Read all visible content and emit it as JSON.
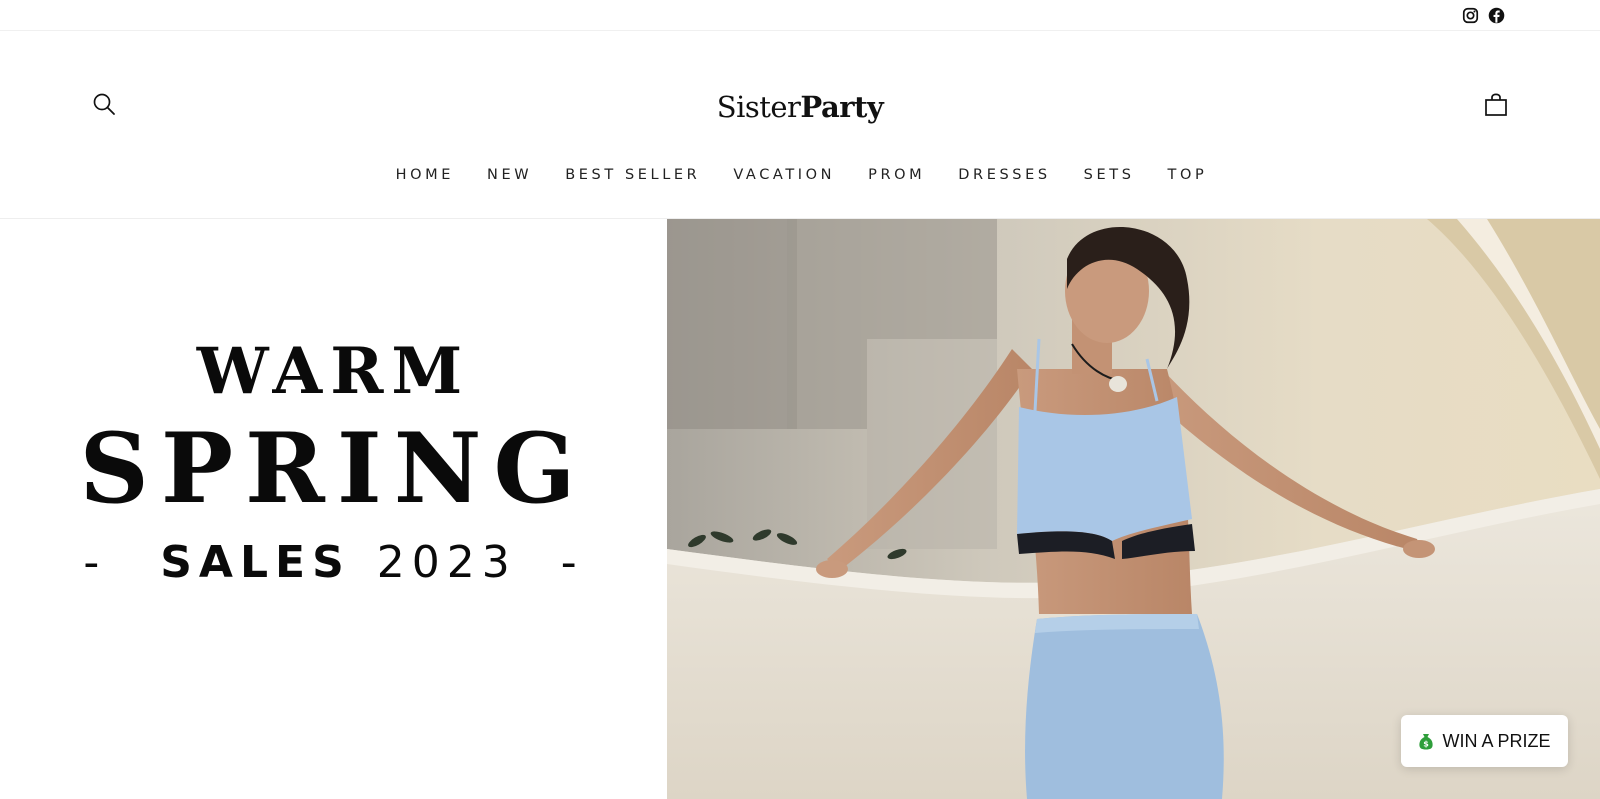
{
  "topbar": {
    "social": [
      {
        "icon": "instagram-icon",
        "label": "Instagram"
      },
      {
        "icon": "facebook-icon",
        "label": "Facebook"
      }
    ]
  },
  "header": {
    "logo": {
      "part1": "Sister",
      "part2": "Party"
    },
    "search_icon": "search-icon",
    "cart_icon": "shopping-bag-icon",
    "nav": [
      "HOME",
      "NEW",
      "BEST SELLER",
      "VACATION",
      "PROM",
      "DRESSES",
      "SETS",
      "TOP"
    ]
  },
  "hero": {
    "line1": "WARM",
    "line2": "SPRING",
    "dash_left": "-",
    "sales_word": "SALES",
    "year": "2023",
    "dash_right": "-"
  },
  "prize_button": {
    "icon": "money-bag-icon",
    "label": "WIN A PRIZE"
  },
  "colors": {
    "text": "#111111",
    "skirt_blue": "#9fbede",
    "wall": "#e9e2d4",
    "money_green": "#2e9e3a"
  }
}
